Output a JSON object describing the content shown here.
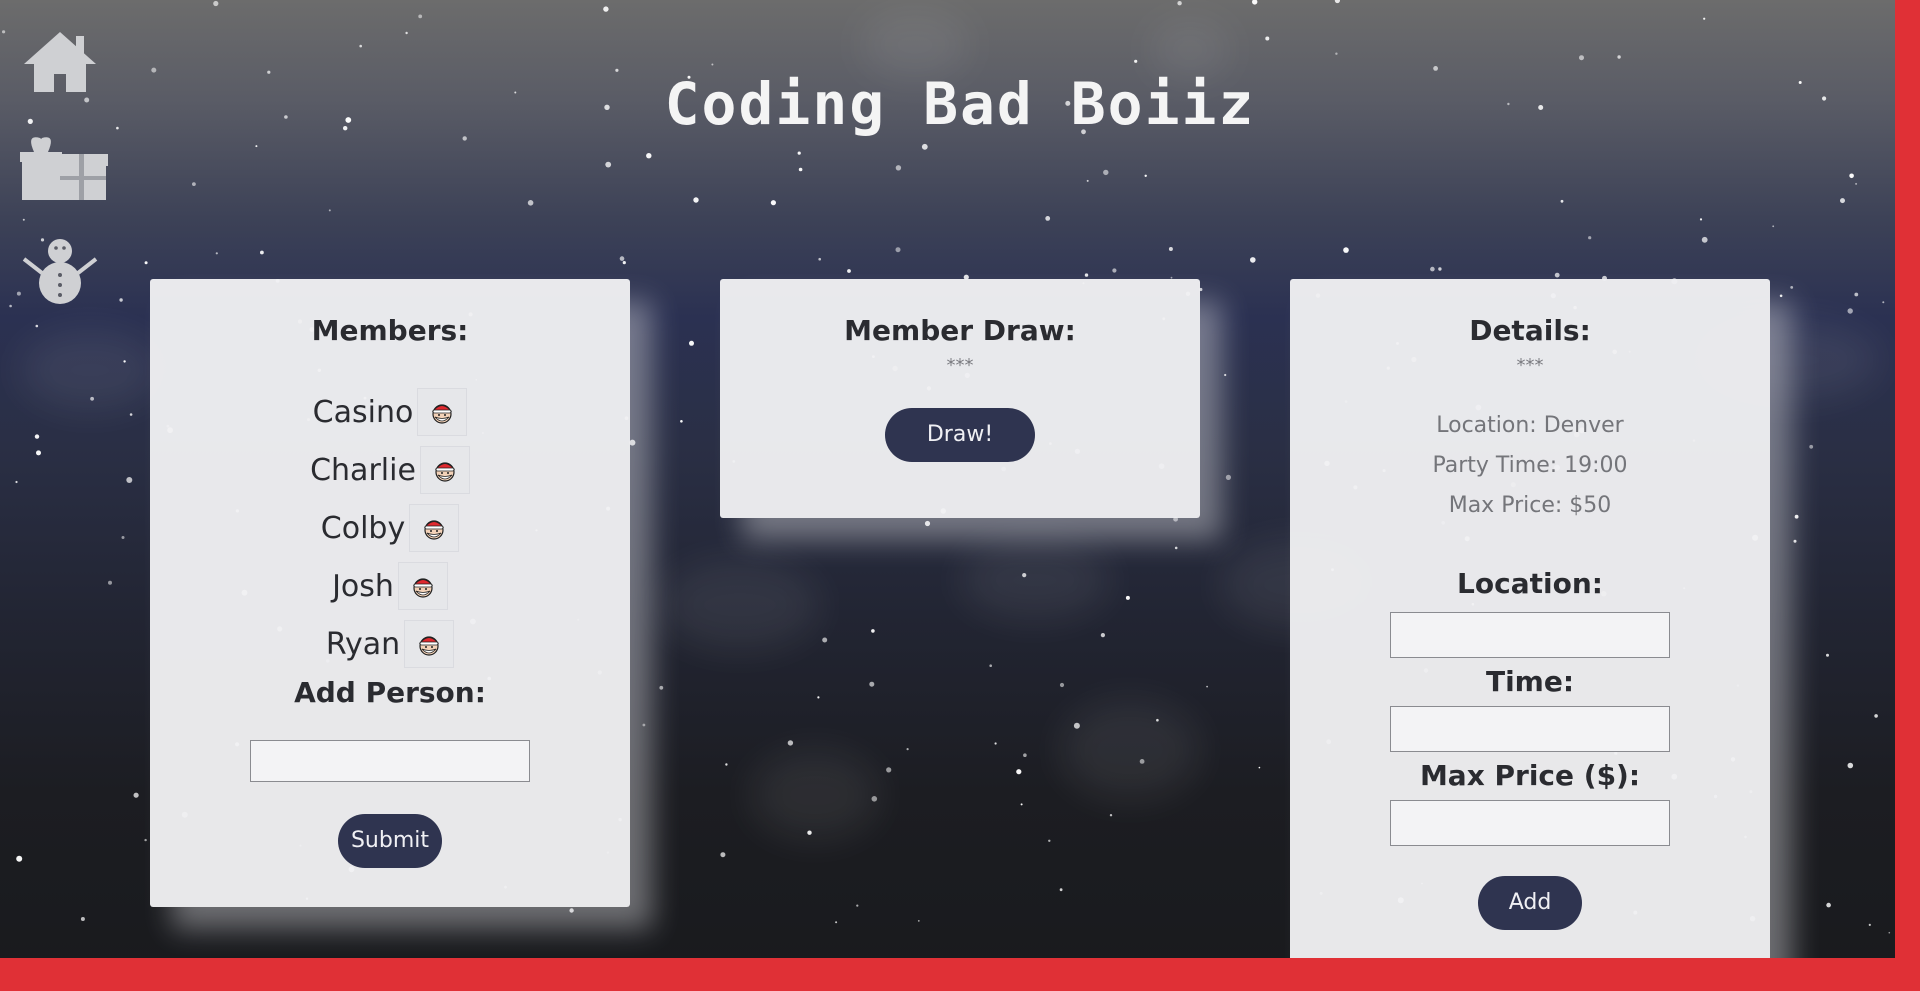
{
  "app": {
    "title": "Coding Bad Boiiz",
    "accent_color": "#e03036",
    "button_color": "#2f3450"
  },
  "nav": {
    "icons": [
      "home-icon",
      "gifts-icon",
      "snowman-icon"
    ]
  },
  "members_panel": {
    "heading": "Members:",
    "members": [
      {
        "name": "Casino",
        "icon": "santa-icon"
      },
      {
        "name": "Charlie",
        "icon": "santa-icon"
      },
      {
        "name": "Colby",
        "icon": "santa-icon"
      },
      {
        "name": "Josh",
        "icon": "santa-icon"
      },
      {
        "name": "Ryan",
        "icon": "santa-icon"
      }
    ],
    "add_heading": "Add Person:",
    "add_input_value": "",
    "submit_label": "Submit"
  },
  "draw_panel": {
    "heading": "Member Draw:",
    "result": "***",
    "draw_label": "Draw!"
  },
  "details_panel": {
    "heading": "Details:",
    "placeholder": "***",
    "location_line": "Location: Denver",
    "time_line": "Party Time: 19:00",
    "price_line": "Max Price: $50",
    "location_label": "Location:",
    "location_value": "",
    "time_label": "Time:",
    "time_value": "",
    "price_label": "Max Price ($):",
    "price_value": "",
    "add_label": "Add"
  }
}
